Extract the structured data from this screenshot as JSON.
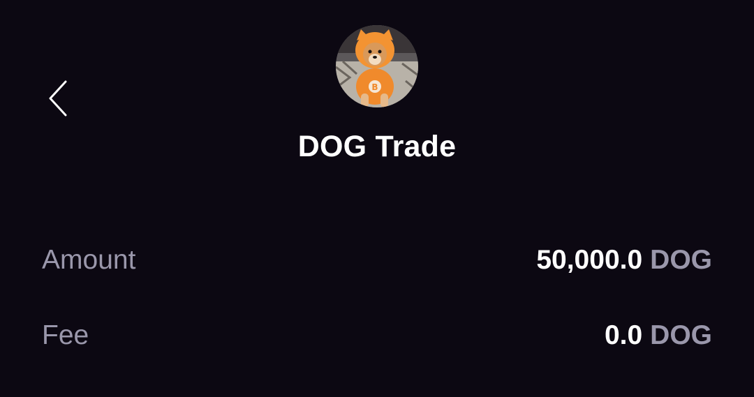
{
  "header": {
    "back_icon": "chevron-left-icon",
    "avatar_icon": "dog-in-orange-hoodie-avatar",
    "title": "DOG Trade"
  },
  "details": {
    "amount": {
      "label": "Amount",
      "value": "50,000.0",
      "unit": "DOG"
    },
    "fee": {
      "label": "Fee",
      "value": "0.0",
      "unit": "DOG"
    }
  },
  "colors": {
    "background": "#0c0812",
    "primary_text": "#ffffff",
    "secondary_text": "#9a97ab",
    "avatar_accent": "#f08a2c"
  }
}
